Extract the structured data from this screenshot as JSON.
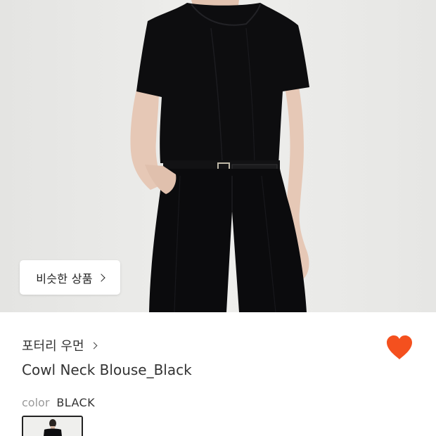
{
  "product_image": {
    "subject": "model wearing black cowl neck blouse and black pleated trousers with belt"
  },
  "similar_button": {
    "label": "비슷한 상품",
    "icon": "chevron-right-icon"
  },
  "brand": {
    "name": "포터리 우먼",
    "icon": "chevron-right-icon"
  },
  "wishlist": {
    "icon": "heart-icon",
    "active": true,
    "color": "#f4501e"
  },
  "product": {
    "name": "Cowl Neck Blouse_Black"
  },
  "color_option": {
    "label": "color",
    "value": "BLACK"
  },
  "colors": {
    "background": "#e9e9e7",
    "text": "#333333",
    "muted": "#9a9a9a",
    "accent": "#f4501e"
  }
}
